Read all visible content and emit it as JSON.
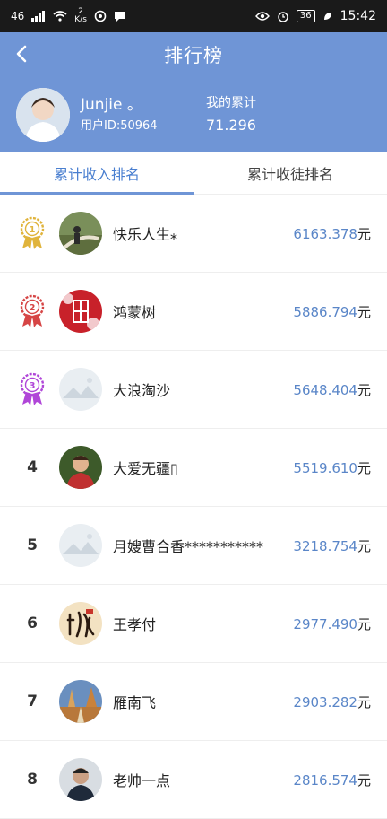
{
  "status_bar": {
    "signal": "46",
    "speed_value": "2",
    "speed_unit": "K/s",
    "battery": "36",
    "time": "15:42"
  },
  "header": {
    "title": "排行榜",
    "user": {
      "name": "Junjie 。",
      "id_label": "用户ID:50964"
    },
    "stat_label": "我的累计",
    "stat_value": "71.296"
  },
  "tabs": [
    {
      "label": "累计收入排名",
      "active": true
    },
    {
      "label": "累计收徒排名",
      "active": false
    }
  ],
  "rankings": [
    {
      "rank": "1",
      "name": "快乐人生⁎",
      "amount": "6163.378",
      "unit": "元"
    },
    {
      "rank": "2",
      "name": "鸿蒙树",
      "amount": "5886.794",
      "unit": "元"
    },
    {
      "rank": "3",
      "name": "大浪淘沙",
      "amount": "5648.404",
      "unit": "元"
    },
    {
      "rank": "4",
      "name": "大爱无疆▯",
      "amount": "5519.610",
      "unit": "元"
    },
    {
      "rank": "5",
      "name": "月嫂曹合香***********",
      "amount": "3218.754",
      "unit": "元"
    },
    {
      "rank": "6",
      "name": "王孝付",
      "amount": "2977.490",
      "unit": "元"
    },
    {
      "rank": "7",
      "name": "雁南飞",
      "amount": "2903.282",
      "unit": "元"
    },
    {
      "rank": "8",
      "name": "老帅一点",
      "amount": "2816.574",
      "unit": "元"
    }
  ],
  "colors": {
    "header_bg": "#6f95d6",
    "accent": "#4a7fd0",
    "amount": "#5a86c8",
    "medal_gold": "#e0b43c",
    "medal_red": "#d64545",
    "medal_purple": "#b046d8"
  }
}
